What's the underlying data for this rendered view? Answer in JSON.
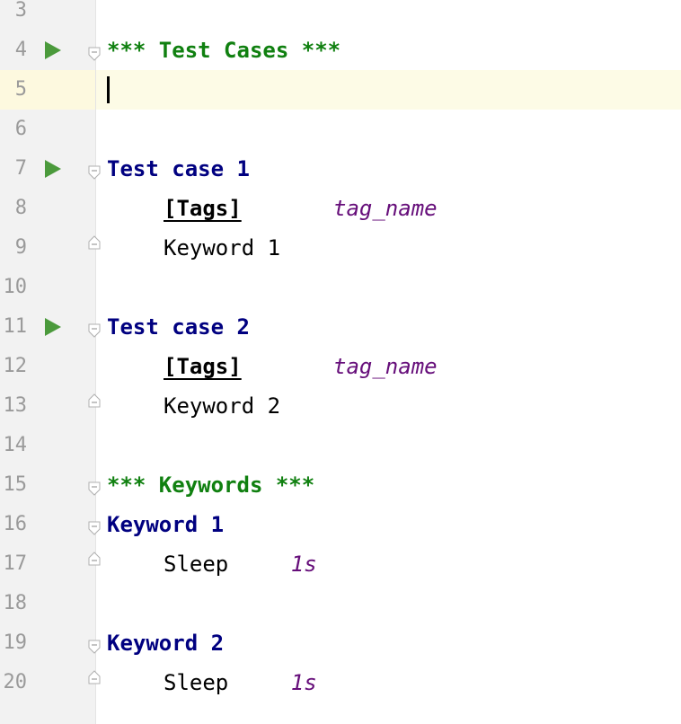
{
  "editor": {
    "lines": [
      {
        "n": "3",
        "parts": []
      },
      {
        "n": "4",
        "run": true,
        "fold": "open",
        "parts": [
          {
            "t": "*** Test Cases ***",
            "c": "section",
            "col": 0
          }
        ]
      },
      {
        "n": "5",
        "current": true,
        "caret": true,
        "parts": []
      },
      {
        "n": "6",
        "parts": []
      },
      {
        "n": "7",
        "run": true,
        "fold": "open",
        "parts": [
          {
            "t": "Test case 1",
            "c": "name",
            "col": 0
          }
        ]
      },
      {
        "n": "8",
        "parts": [
          {
            "t": "[Tags]",
            "c": "setting",
            "col": 4
          },
          {
            "t": "tag_name",
            "c": "arg",
            "col": 16
          }
        ]
      },
      {
        "n": "9",
        "fold": "close",
        "parts": [
          {
            "t": "Keyword 1",
            "c": "plain",
            "col": 4
          }
        ]
      },
      {
        "n": "10",
        "parts": []
      },
      {
        "n": "11",
        "run": true,
        "fold": "open",
        "parts": [
          {
            "t": "Test case 2",
            "c": "name",
            "col": 0
          }
        ]
      },
      {
        "n": "12",
        "parts": [
          {
            "t": "[Tags]",
            "c": "setting",
            "col": 4
          },
          {
            "t": "tag_name",
            "c": "arg",
            "col": 16
          }
        ]
      },
      {
        "n": "13",
        "fold": "close",
        "parts": [
          {
            "t": "Keyword 2",
            "c": "plain",
            "col": 4
          }
        ]
      },
      {
        "n": "14",
        "parts": []
      },
      {
        "n": "15",
        "fold": "open",
        "parts": [
          {
            "t": "*** Keywords ***",
            "c": "section",
            "col": 0
          }
        ]
      },
      {
        "n": "16",
        "fold": "open",
        "parts": [
          {
            "t": "Keyword 1",
            "c": "name",
            "col": 0
          }
        ]
      },
      {
        "n": "17",
        "fold": "close",
        "parts": [
          {
            "t": "Sleep",
            "c": "plain",
            "col": 4
          },
          {
            "t": "1s",
            "c": "arg",
            "col": 13
          }
        ]
      },
      {
        "n": "18",
        "parts": []
      },
      {
        "n": "19",
        "fold": "open",
        "parts": [
          {
            "t": "Keyword 2",
            "c": "name",
            "col": 0
          }
        ]
      },
      {
        "n": "20",
        "fold": "close",
        "parts": [
          {
            "t": "Sleep",
            "c": "plain",
            "col": 4
          },
          {
            "t": "1s",
            "c": "arg",
            "col": 13
          }
        ]
      }
    ]
  },
  "colors": {
    "section": "#108010",
    "name": "#000080",
    "argument": "#660e7a",
    "run_icon": "#4b9a3c",
    "current_line": "#fdfbe6"
  },
  "icons": {
    "run": "run-triangle-icon",
    "fold_open": "fold-open-icon",
    "fold_close": "fold-close-icon"
  }
}
